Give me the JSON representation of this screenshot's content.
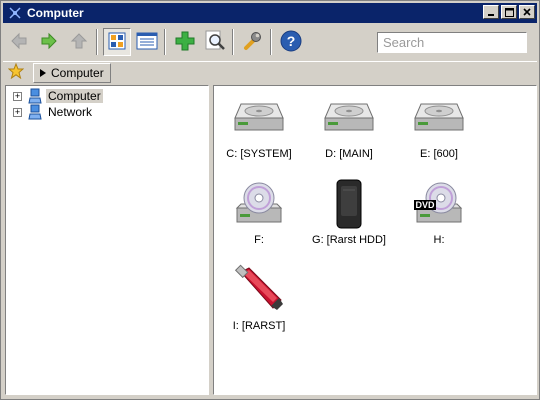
{
  "window": {
    "title": "Computer"
  },
  "toolbar": {
    "buttons": [
      {
        "name": "back",
        "icon": "arrow-left-icon"
      },
      {
        "name": "forward",
        "icon": "arrow-right-icon"
      },
      {
        "name": "up",
        "icon": "arrow-up-icon"
      },
      {
        "name": "large-icons-view",
        "icon": "icons-view-icon"
      },
      {
        "name": "details-view",
        "icon": "details-view-icon"
      },
      {
        "name": "add",
        "icon": "plus-icon"
      },
      {
        "name": "find",
        "icon": "magnifier-icon"
      },
      {
        "name": "settings",
        "icon": "wrench-icon"
      },
      {
        "name": "help",
        "icon": "help-icon"
      }
    ]
  },
  "search": {
    "placeholder": "Search"
  },
  "address": {
    "crumb": "Computer"
  },
  "tree": {
    "items": [
      {
        "label": "Computer",
        "expander": "+"
      },
      {
        "label": "Network",
        "expander": "+"
      }
    ]
  },
  "drives": [
    {
      "label": "C: [SYSTEM]",
      "icon": "hard-drive-icon"
    },
    {
      "label": "D: [MAIN]",
      "icon": "hard-drive-icon"
    },
    {
      "label": "E: [600]",
      "icon": "hard-drive-icon"
    },
    {
      "label": "F:",
      "icon": "cd-drive-icon"
    },
    {
      "label": "G: [Rarst HDD]",
      "icon": "external-hdd-icon"
    },
    {
      "label": "H:",
      "icon": "dvd-drive-icon",
      "badge": "DVD"
    },
    {
      "label": "I: [RARST]",
      "icon": "usb-flash-icon"
    }
  ],
  "colors": {
    "titlebar": "#0a246a",
    "chrome": "#d4d0c8",
    "usb_red": "#c8102e"
  }
}
